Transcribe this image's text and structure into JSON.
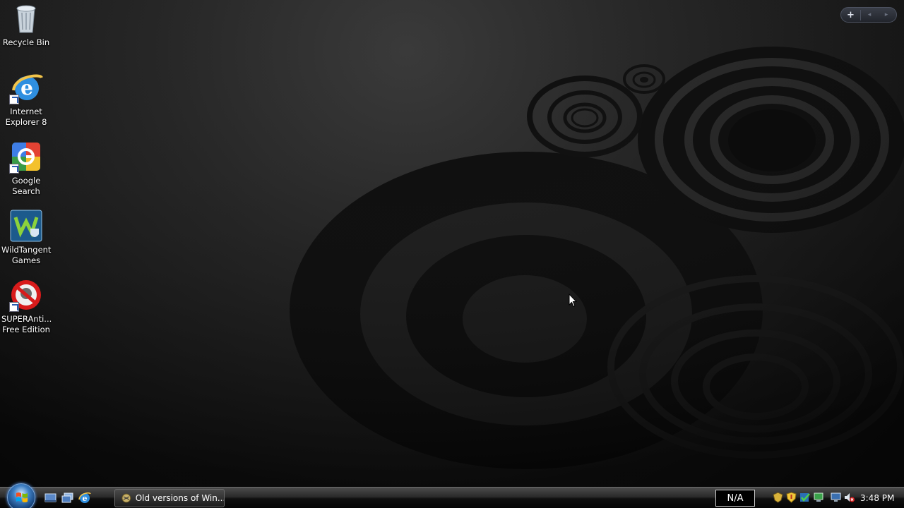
{
  "desktop": {
    "icons": [
      {
        "label": "Recycle Bin",
        "icon": "recycle-bin-icon"
      },
      {
        "label": "Internet Explorer 8",
        "icon": "internet-explorer-icon"
      },
      {
        "label": "Google Search",
        "icon": "google-search-icon"
      },
      {
        "label": "WildTangent Games",
        "icon": "wildtangent-icon"
      },
      {
        "label": "SUPERAnti... Free Edition",
        "icon": "superantispyware-icon"
      }
    ]
  },
  "gadgets": {
    "add_label": "+",
    "prev_label": "◂",
    "next_label": "▸"
  },
  "taskbar": {
    "quick_launch": [
      "show-desktop-icon",
      "switch-windows-icon",
      "internet-explorer-icon"
    ],
    "task_button_label": "Old versions of Win...",
    "language_bar": "N/A",
    "tray_icons": [
      "security-shield-icon",
      "antivirus-shield-icon",
      "checkmark-shield-icon",
      "network-icon",
      "monitor-icon",
      "volume-muted-icon"
    ],
    "clock": "3:48 PM"
  }
}
